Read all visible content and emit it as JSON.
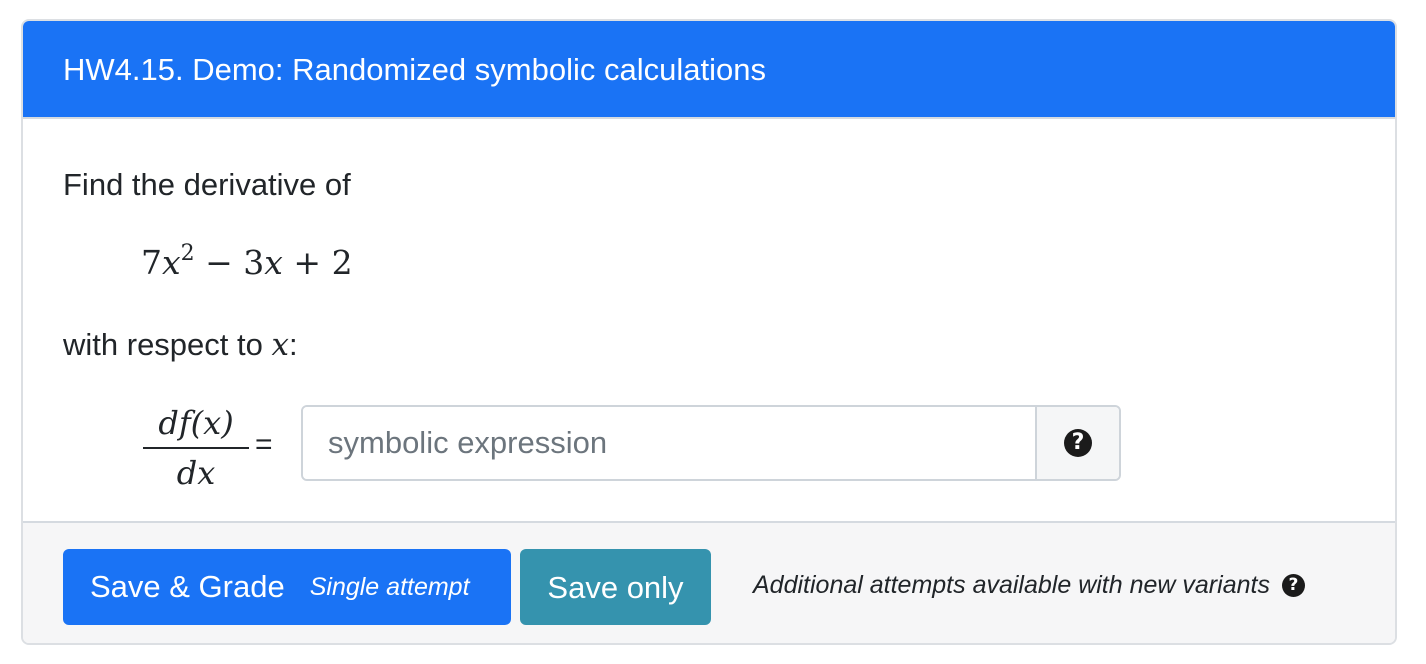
{
  "header": {
    "title": "HW4.15. Demo: Randomized symbolic calculations"
  },
  "question": {
    "prompt": "Find the derivative of",
    "expression": {
      "coef1": "7",
      "var": "x",
      "power": "2",
      "rest_op": "−",
      "coef2": "3",
      "var2": "x",
      "op2": "+",
      "const": "2"
    },
    "respect_text": "with respect to",
    "respect_var": "x",
    "respect_suffix": ":",
    "fraction": {
      "numerator": "df(x)",
      "denominator": "dx"
    },
    "equals": "=",
    "input": {
      "placeholder": "symbolic expression",
      "value": ""
    },
    "help_icon": "question-circle-icon"
  },
  "footer": {
    "grade_label": "Save & Grade",
    "grade_sub": "Single attempt",
    "save_label": "Save only",
    "attempts_note": "Additional attempts available with new variants"
  },
  "colors": {
    "primary": "#1a73f5",
    "info": "#3593ae",
    "footer_bg": "#f6f6f7"
  }
}
